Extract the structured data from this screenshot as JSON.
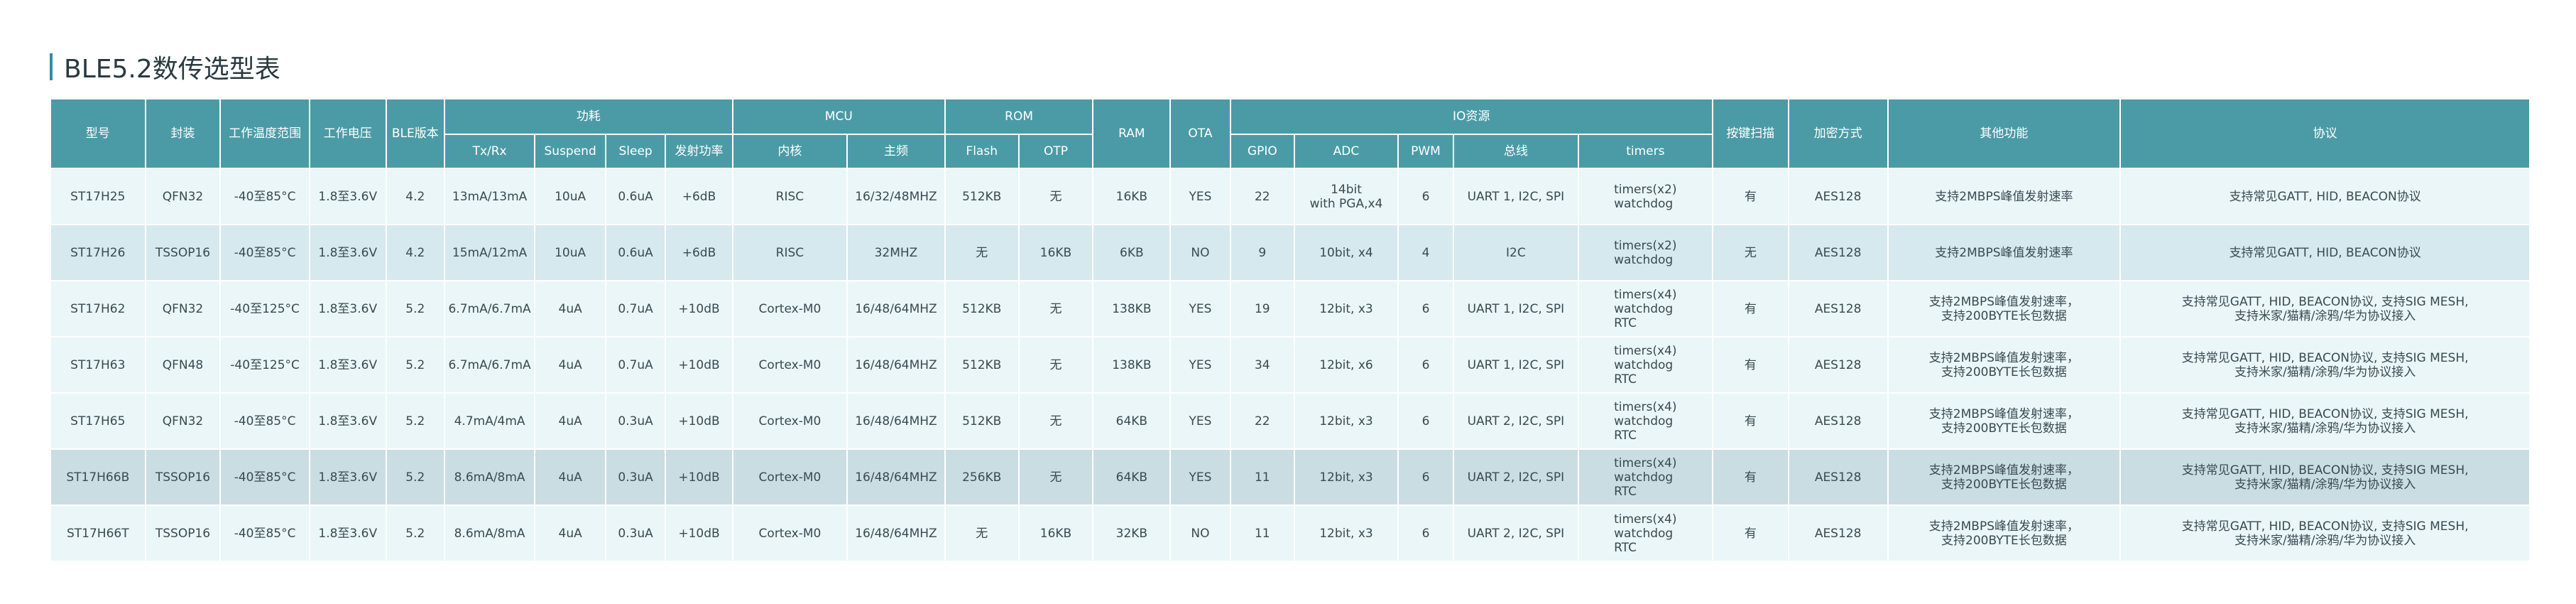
{
  "title": "BLE5.2数传选型表",
  "header": {
    "row1": {
      "model": "型号",
      "package": "封装",
      "temp": "工作温度范围",
      "voltage": "工作电压",
      "ble": "BLE版本",
      "power": "功耗",
      "mcu": "MCU",
      "rom": "ROM",
      "ram": "RAM",
      "ota": "OTA",
      "io": "IO资源",
      "scan": "按键扫描",
      "encrypt": "加密方式",
      "other": "其他功能",
      "protocol": "协议"
    },
    "row2": {
      "txrx": "Tx/Rx",
      "suspend": "Suspend",
      "sleep": "Sleep",
      "txpower": "发射功率",
      "core": "内核",
      "freq": "主频",
      "flash": "Flash",
      "otp": "OTP",
      "gpio": "GPIO",
      "adc": "ADC",
      "pwm": "PWM",
      "bus": "总线",
      "timers": "timers"
    }
  },
  "rows": [
    {
      "model": "ST17H25",
      "package": "QFN32",
      "temp": "-40至85°C",
      "voltage": "1.8至3.6V",
      "ble": "4.2",
      "txrx": "13mA/13mA",
      "suspend": "10uA",
      "sleep": "0.6uA",
      "txpower": "+6dB",
      "core": "RISC",
      "freq": "16/32/48MHZ",
      "flash": "512KB",
      "otp": "无",
      "ram": "16KB",
      "ota": "YES",
      "gpio": "22",
      "adc": [
        "14bit",
        "with PGA,x4"
      ],
      "pwm": "6",
      "bus": "UART 1, I2C, SPI",
      "timers": [
        "timers(x2)",
        "watchdog"
      ],
      "scan": "有",
      "encrypt": "AES128",
      "other": [
        "支持2MBPS峰值发射速率"
      ],
      "protocol": [
        "支持常见GATT, HID, BEACON协议"
      ]
    },
    {
      "model": "ST17H26",
      "package": "TSSOP16",
      "temp": "-40至85°C",
      "voltage": "1.8至3.6V",
      "ble": "4.2",
      "txrx": "15mA/12mA",
      "suspend": "10uA",
      "sleep": "0.6uA",
      "txpower": "+6dB",
      "core": "RISC",
      "freq": "32MHZ",
      "flash": "无",
      "otp": "16KB",
      "ram": "6KB",
      "ota": "NO",
      "gpio": "9",
      "adc": [
        "10bit, x4"
      ],
      "pwm": "4",
      "bus": "I2C",
      "timers": [
        "timers(x2)",
        "watchdog"
      ],
      "scan": "无",
      "encrypt": "AES128",
      "other": [
        "支持2MBPS峰值发射速率"
      ],
      "protocol": [
        "支持常见GATT, HID, BEACON协议"
      ]
    },
    {
      "model": "ST17H62",
      "package": "QFN32",
      "temp": "-40至125°C",
      "voltage": "1.8至3.6V",
      "ble": "5.2",
      "txrx": "6.7mA/6.7mA",
      "suspend": "4uA",
      "sleep": "0.7uA",
      "txpower": "+10dB",
      "core": "Cortex-M0",
      "freq": "16/48/64MHZ",
      "flash": "512KB",
      "otp": "无",
      "ram": "138KB",
      "ota": "YES",
      "gpio": "19",
      "adc": [
        "12bit, x3"
      ],
      "pwm": "6",
      "bus": "UART 1, I2C, SPI",
      "timers": [
        "timers(x4)",
        "watchdog",
        "RTC"
      ],
      "scan": "有",
      "encrypt": "AES128",
      "other": [
        "支持2MBPS峰值发射速率，",
        "支持200BYTE长包数据"
      ],
      "protocol": [
        "支持常见GATT, HID, BEACON协议, 支持SIG MESH,",
        "支持米家/猫精/涂鸦/华为协议接入"
      ]
    },
    {
      "model": "ST17H63",
      "package": "QFN48",
      "temp": "-40至125°C",
      "voltage": "1.8至3.6V",
      "ble": "5.2",
      "txrx": "6.7mA/6.7mA",
      "suspend": "4uA",
      "sleep": "0.7uA",
      "txpower": "+10dB",
      "core": "Cortex-M0",
      "freq": "16/48/64MHZ",
      "flash": "512KB",
      "otp": "无",
      "ram": "138KB",
      "ota": "YES",
      "gpio": "34",
      "adc": [
        "12bit, x6"
      ],
      "pwm": "6",
      "bus": "UART 1, I2C, SPI",
      "timers": [
        "timers(x4)",
        "watchdog",
        "RTC"
      ],
      "scan": "有",
      "encrypt": "AES128",
      "other": [
        "支持2MBPS峰值发射速率，",
        "支持200BYTE长包数据"
      ],
      "protocol": [
        "支持常见GATT, HID, BEACON协议, 支持SIG MESH,",
        "支持米家/猫精/涂鸦/华为协议接入"
      ]
    },
    {
      "model": "ST17H65",
      "package": "QFN32",
      "temp": "-40至85°C",
      "voltage": "1.8至3.6V",
      "ble": "5.2",
      "txrx": "4.7mA/4mA",
      "suspend": "4uA",
      "sleep": "0.3uA",
      "txpower": "+10dB",
      "core": "Cortex-M0",
      "freq": "16/48/64MHZ",
      "flash": "512KB",
      "otp": "无",
      "ram": "64KB",
      "ota": "YES",
      "gpio": "22",
      "adc": [
        "12bit, x3"
      ],
      "pwm": "6",
      "bus": "UART 2, I2C, SPI",
      "timers": [
        "timers(x4)",
        "watchdog",
        "RTC"
      ],
      "scan": "有",
      "encrypt": "AES128",
      "other": [
        "支持2MBPS峰值发射速率，",
        "支持200BYTE长包数据"
      ],
      "protocol": [
        "支持常见GATT, HID, BEACON协议, 支持SIG MESH,",
        "支持米家/猫精/涂鸦/华为协议接入"
      ]
    },
    {
      "model": "ST17H66B",
      "package": "TSSOP16",
      "temp": "-40至85°C",
      "voltage": "1.8至3.6V",
      "ble": "5.2",
      "txrx": "8.6mA/8mA",
      "suspend": "4uA",
      "sleep": "0.3uA",
      "txpower": "+10dB",
      "core": "Cortex-M0",
      "freq": "16/48/64MHZ",
      "flash": "256KB",
      "otp": "无",
      "ram": "64KB",
      "ota": "YES",
      "gpio": "11",
      "adc": [
        "12bit, x3"
      ],
      "pwm": "6",
      "bus": "UART 2, I2C, SPI",
      "timers": [
        "timers(x4)",
        "watchdog",
        "RTC"
      ],
      "scan": "有",
      "encrypt": "AES128",
      "other": [
        "支持2MBPS峰值发射速率，",
        "支持200BYTE长包数据"
      ],
      "protocol": [
        "支持常见GATT, HID, BEACON协议, 支持SIG MESH,",
        "支持米家/猫精/涂鸦/华为协议接入"
      ]
    },
    {
      "model": "ST17H66T",
      "package": "TSSOP16",
      "temp": "-40至85°C",
      "voltage": "1.8至3.6V",
      "ble": "5.2",
      "txrx": "8.6mA/8mA",
      "suspend": "4uA",
      "sleep": "0.3uA",
      "txpower": "+10dB",
      "core": "Cortex-M0",
      "freq": "16/48/64MHZ",
      "flash": "无",
      "otp": "16KB",
      "ram": "32KB",
      "ota": "NO",
      "gpio": "11",
      "adc": [
        "12bit, x3"
      ],
      "pwm": "6",
      "bus": "UART 2, I2C, SPI",
      "timers": [
        "timers(x4)",
        "watchdog",
        "RTC"
      ],
      "scan": "有",
      "encrypt": "AES128",
      "other": [
        "支持2MBPS峰值发射速率，",
        "支持200BYTE长包数据"
      ],
      "protocol": [
        "支持常见GATT, HID, BEACON协议, 支持SIG MESH,",
        "支持米家/猫精/涂鸦/华为协议接入"
      ]
    }
  ],
  "colors": {
    "header_bg": "#4b9ba6",
    "accent": "#2f8fa6",
    "row_light": "#eaf6f8",
    "row_mid": "#d5e9ee",
    "row_dark": "#cadde3"
  }
}
